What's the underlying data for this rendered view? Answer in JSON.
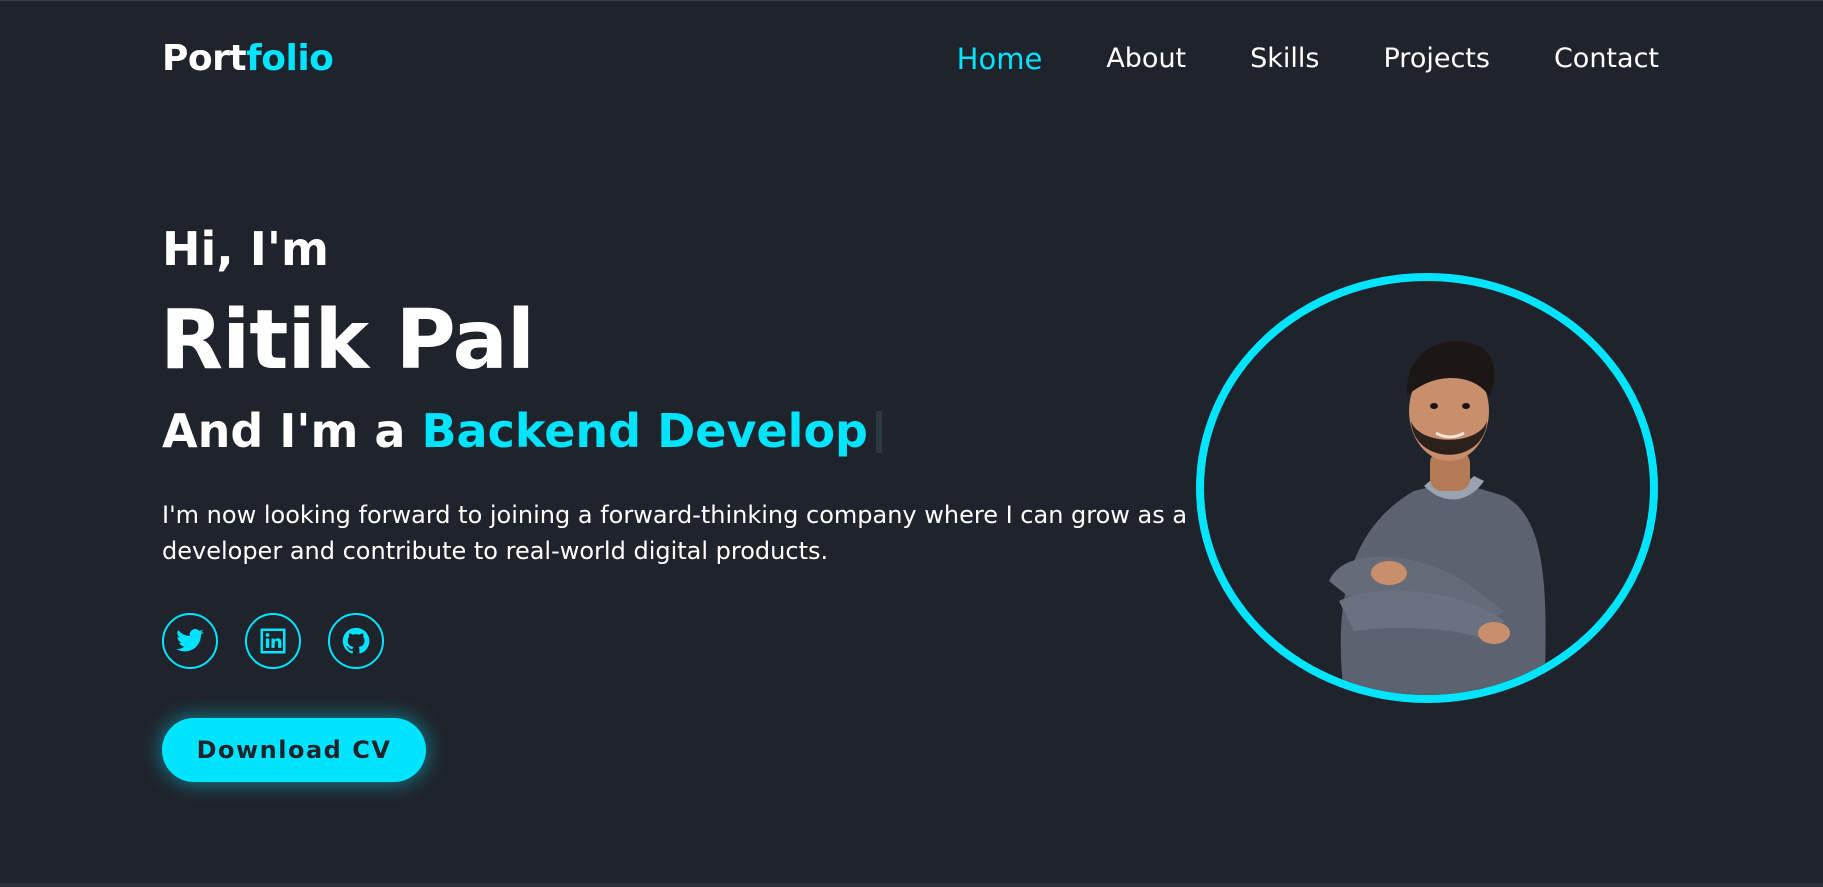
{
  "header": {
    "logo_part1": "Port",
    "logo_part2": "folio",
    "nav": [
      {
        "label": "Home",
        "active": true
      },
      {
        "label": "About",
        "active": false
      },
      {
        "label": "Skills",
        "active": false
      },
      {
        "label": "Projects",
        "active": false
      },
      {
        "label": "Contact",
        "active": false
      }
    ]
  },
  "hero": {
    "greeting": "Hi, I'm",
    "name": "Ritik Pal",
    "role_prefix": "And I'm a ",
    "role_typed": "Backend Develop",
    "description": "I'm now looking forward to joining a forward-thinking company where I can grow as a developer and contribute to real-world digital products.",
    "socials": [
      {
        "icon": "twitter-icon"
      },
      {
        "icon": "linkedin-icon"
      },
      {
        "icon": "github-icon"
      }
    ],
    "cv_button": "Download CV",
    "portrait_icon": "profile-photo"
  },
  "colors": {
    "background": "#1f232b",
    "accent": "#00e5ff",
    "text": "#ffffff"
  }
}
